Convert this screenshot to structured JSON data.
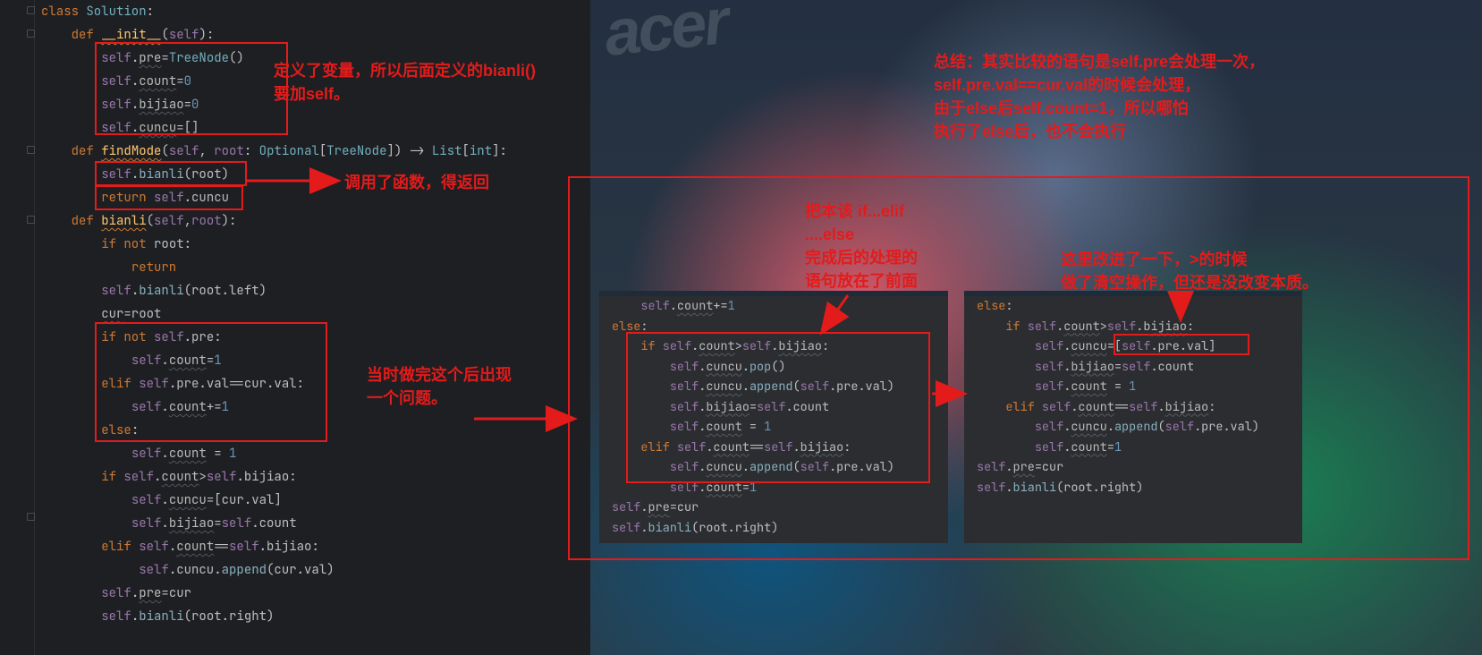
{
  "editor": {
    "lines": {
      "l1": "class Solution:",
      "l2": "    def __init__(self):",
      "l3": "        self.pre=TreeNode()",
      "l4": "        self.count=0",
      "l5": "        self.bijiao=0",
      "l6": "        self.cuncu=[]",
      "l7": "    def findMode(self, root: Optional[TreeNode]) -> List[int]:",
      "l8": "        self.bianli(root)",
      "l9": "        return self.cuncu",
      "l10": "    def bianli(self,root):",
      "l11": "        if not root:",
      "l12": "            return",
      "l13": "        self.bianli(root.left)",
      "l14": "        cur=root",
      "l15": "        if not self.pre:",
      "l16": "            self.count=1",
      "l17": "        elif self.pre.val==cur.val:",
      "l18": "            self.count+=1",
      "l19": "        else:",
      "l20": "            self.count = 1",
      "l21": "        if self.count>self.bijiao:",
      "l22": "            self.cuncu=[cur.val]",
      "l23": "            self.bijiao=self.count",
      "l24": "        elif self.count==self.bijiao:",
      "l25": "             self.cuncu.append(cur.val)",
      "l26": "        self.pre=cur",
      "l27": "        self.bianli(root.right)"
    }
  },
  "notes": {
    "n1a": "定义了变量，所以后面定义的bianli()",
    "n1b": "要加self。",
    "n2": "调用了函数，得返回",
    "n3a": "当时做完这个后出现",
    "n3b": "一个问题。",
    "summary1": "总结：其实比较的语句是self.pre会处理一次，",
    "summary2": "self.pre.val==cur.val的时候会处理，",
    "summary3": "由于else后self.count=1，所以哪怕",
    "summary4": "执行了else后，也不会执行",
    "mid1": "把本该 if...elif",
    "mid2": "         ....else",
    "mid3": "完成后的处理的",
    "mid4": "语句放在了前面",
    "right1": "这里改进了一下，>的时候",
    "right2": "做了清空操作，但还是没改变本质。"
  },
  "snippetA": {
    "s1": "    self.count+=1",
    "s2": "else:",
    "s3": "    if self.count>self.bijiao:",
    "s4": "        self.cuncu.pop()",
    "s5": "        self.cuncu.append(self.pre.val)",
    "s6": "        self.bijiao=self.count",
    "s7": "        self.count = 1",
    "s8": "    elif self.count==self.bijiao:",
    "s9": "        self.cuncu.append(self.pre.val)",
    "s10": "        self.count=1",
    "s11": "self.pre=cur",
    "s12": "self.bianli(root.right)"
  },
  "snippetB": {
    "s1": "else:",
    "s2": "    if self.count>self.bijiao:",
    "s3": "        self.cuncu=[self.pre.val]",
    "s4": "        self.bijiao=self.count",
    "s5": "        self.count = 1",
    "s6": "    elif self.count==self.bijiao:",
    "s7": "        self.cuncu.append(self.pre.val)",
    "s8": "        self.count=1",
    "s9": "self.pre=cur",
    "s10": "self.bianli(root.right)"
  },
  "brand": "acer"
}
